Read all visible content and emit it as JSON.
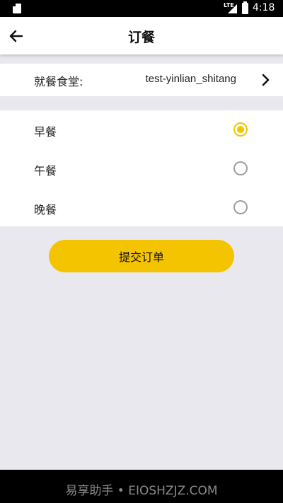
{
  "status_bar": {
    "network": "LTE",
    "time": "4:18"
  },
  "header": {
    "title": "订餐",
    "back_icon": "arrow-left-icon"
  },
  "canteen": {
    "label": "就餐食堂:",
    "value": "test-yinlian_shitang",
    "icon": "chevron-right-icon"
  },
  "meals": [
    {
      "label": "早餐",
      "selected": true
    },
    {
      "label": "午餐",
      "selected": false
    },
    {
      "label": "晚餐",
      "selected": false
    }
  ],
  "submit": {
    "label": "提交订单"
  },
  "watermark": {
    "text": "易享助手 • EIOSHZJZ.COM"
  },
  "colors": {
    "accent": "#f5c400",
    "background": "#e9e8ee",
    "radio_unchecked": "#9e9e9e"
  }
}
